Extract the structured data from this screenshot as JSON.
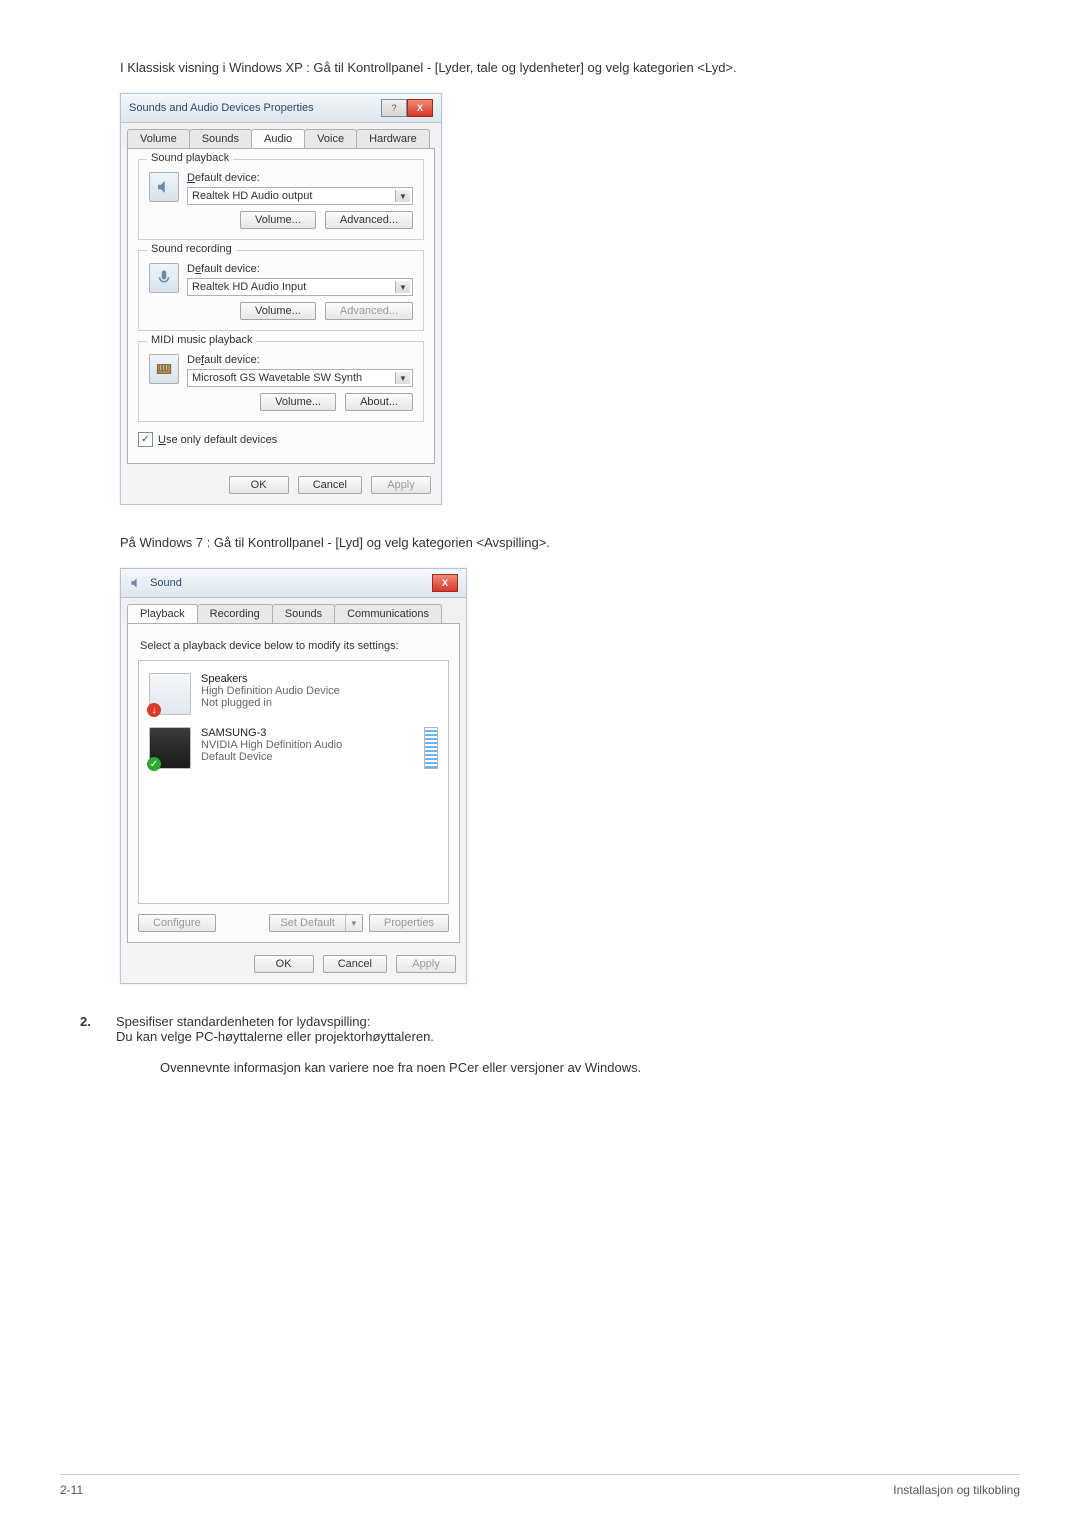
{
  "intro1": "I Klassisk visning i Windows XP : Gå til Kontrollpanel - [Lyder, tale og lydenheter] og velg kategorien <Lyd>.",
  "intro2": "På Windows 7 : Gå til Kontrollpanel - [Lyd] og velg kategorien <Avspilling>.",
  "xp": {
    "title": "Sounds and Audio Devices Properties",
    "tabs": {
      "volume": "Volume",
      "sounds": "Sounds",
      "audio": "Audio",
      "voice": "Voice",
      "hardware": "Hardware"
    },
    "groups": {
      "playback": {
        "title": "Sound playback",
        "label": "Default device:",
        "value": "Realtek HD Audio output",
        "volume": "Volume...",
        "advanced": "Advanced..."
      },
      "recording": {
        "title": "Sound recording",
        "label": "Default device:",
        "value": "Realtek HD Audio Input",
        "volume": "Volume...",
        "advanced": "Advanced..."
      },
      "midi": {
        "title": "MIDI music playback",
        "label": "Default device:",
        "value": "Microsoft GS Wavetable SW Synth",
        "volume": "Volume...",
        "about": "About..."
      }
    },
    "checkbox": "Use only default devices",
    "buttons": {
      "ok": "OK",
      "cancel": "Cancel",
      "apply": "Apply"
    }
  },
  "win7": {
    "title": "Sound",
    "tabs": {
      "playback": "Playback",
      "recording": "Recording",
      "sounds": "Sounds",
      "communications": "Communications"
    },
    "instruction": "Select a playback device below to modify its settings:",
    "devices": [
      {
        "name": "Speakers",
        "line2": "High Definition Audio Device",
        "line3": "Not plugged in"
      },
      {
        "name": "SAMSUNG-3",
        "line2": "NVIDIA High Definition Audio",
        "line3": "Default Device"
      }
    ],
    "configure": "Configure",
    "setdefault": "Set Default",
    "properties": "Properties",
    "buttons": {
      "ok": "OK",
      "cancel": "Cancel",
      "apply": "Apply"
    }
  },
  "step": {
    "num": "2.",
    "line1": "Spesifiser standardenheten for lydavspilling:",
    "line2": "Du kan velge PC-høyttalerne eller projektorhøyttaleren."
  },
  "note": "Ovennevnte informasjon kan variere noe fra noen PCer eller versjoner av Windows.",
  "footer": {
    "left": "2-11",
    "right": "Installasjon og tilkobling"
  }
}
